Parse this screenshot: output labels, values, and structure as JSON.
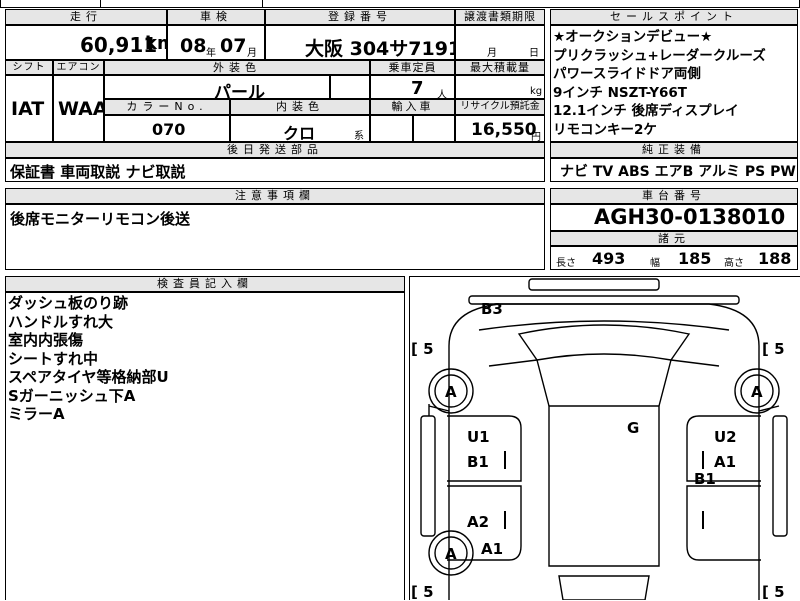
{
  "top_partial": {
    "left_text": "...",
    "center_text": "...",
    "right_text": "..."
  },
  "headers": {
    "mileage": "走行",
    "inspection": "車検",
    "registration": "登録番号",
    "transfer_deadline": "譲渡書類期限",
    "sales_point": "セールスポイント",
    "shift": "シフト",
    "aircon": "エアコン",
    "exterior_color": "外装色",
    "capacity": "乗車定員",
    "max_load": "最大積載量",
    "color_no": "カラーNo.",
    "interior_color": "内装色",
    "import_car": "輸入車",
    "recycle_fee": "リサイクル預託金",
    "deferred_parts": "後日発送部品",
    "genuine_equipment": "純正装備",
    "notes": "注意事項欄",
    "chassis_no": "車台番号",
    "specs": "諸元",
    "inspector_notes": "検査員記入欄"
  },
  "mileage": {
    "value": "60,911",
    "unit": "km"
  },
  "inspection": {
    "year": "08",
    "year_unit": "年",
    "month": "07",
    "month_unit": "月"
  },
  "registration": {
    "value": "大阪 304サ7191"
  },
  "transfer_deadline": {
    "month_unit": "月",
    "day_unit": "日"
  },
  "sales_point": {
    "lines": [
      "★オークションデビュー★",
      "プリクラッシュ+レーダークルーズ",
      "パワースライドドア両側",
      "9インチ NSZT-Y66T",
      "12.1インチ 後席ディスプレイ",
      "リモコンキー2ケ"
    ]
  },
  "shift": {
    "value": "IAT"
  },
  "aircon": {
    "value": "WAA"
  },
  "exterior_color": {
    "value": "パール"
  },
  "capacity": {
    "value": "7",
    "unit": "人"
  },
  "max_load": {
    "unit": "kg"
  },
  "color_no": {
    "value": "070"
  },
  "interior_color": {
    "value": "クロ",
    "suffix": "系"
  },
  "recycle_fee": {
    "value": "16,550",
    "unit": "円"
  },
  "deferred_parts": {
    "value": "保証書 車両取説 ナビ取説"
  },
  "genuine_equipment": {
    "value": "ナビ TV ABS エアB アルミ PS PW"
  },
  "notes": {
    "value": "後席モニターリモコン後送"
  },
  "chassis_no": {
    "value": "AGH30-0138010"
  },
  "specs": {
    "length_label": "長さ",
    "length": "493",
    "width_label": "幅",
    "width": "185",
    "height_label": "高さ",
    "height": "188"
  },
  "inspector_notes": {
    "lines": [
      "ダッシュ板のり跡",
      "ハンドルすれ大",
      "室内内張傷",
      "シートすれ中",
      "スペアタイヤ等格納部U",
      "Sガーニッシュ下A",
      "ミラーA"
    ]
  },
  "diagram": {
    "labels": {
      "b3": "B3",
      "tl_tire": "[ 5",
      "tr_tire": "[ 5",
      "bl_tire": "[ 5",
      "br_tire": "[ 5",
      "a_front_left": "A",
      "a_front_right": "A",
      "a_rear_left": "A",
      "u1": "U1",
      "b1_left": "B1",
      "g": "G",
      "u2": "U2",
      "a1_right": "A1",
      "b1_right": "B1",
      "a2_left": "A2",
      "a1_left": "A1"
    }
  }
}
